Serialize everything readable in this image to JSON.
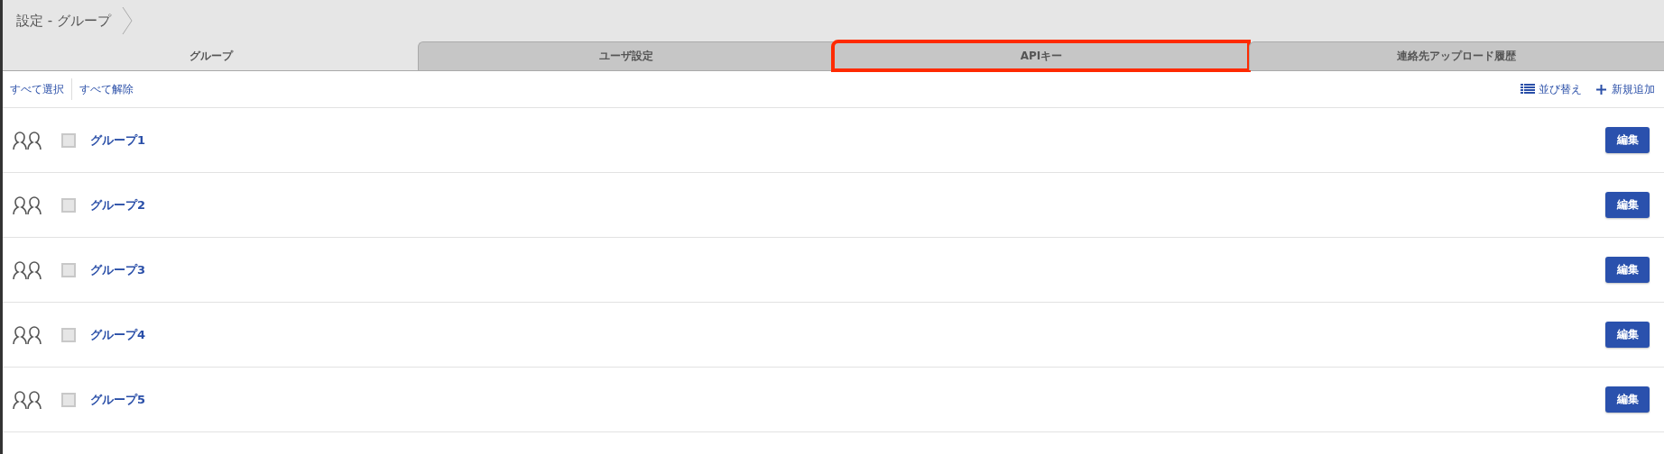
{
  "breadcrumb": {
    "title": "設定 - グループ"
  },
  "tabs": [
    {
      "label": "グループ",
      "selected": true,
      "highlighted": false
    },
    {
      "label": "ユーザ設定",
      "selected": false,
      "highlighted": false
    },
    {
      "label": "APIキー",
      "selected": false,
      "highlighted": true
    },
    {
      "label": "連絡先アップロード履歴",
      "selected": false,
      "highlighted": false
    }
  ],
  "toolbar": {
    "select_all": "すべて選択",
    "deselect_all": "すべて解除",
    "sort": "並び替え",
    "add": "新規追加"
  },
  "groups": [
    {
      "name": "グループ1",
      "checked": false,
      "action": "編集"
    },
    {
      "name": "グループ2",
      "checked": false,
      "action": "編集"
    },
    {
      "name": "グループ3",
      "checked": false,
      "action": "編集"
    },
    {
      "name": "グループ4",
      "checked": false,
      "action": "編集"
    },
    {
      "name": "グループ5",
      "checked": false,
      "action": "編集"
    }
  ]
}
